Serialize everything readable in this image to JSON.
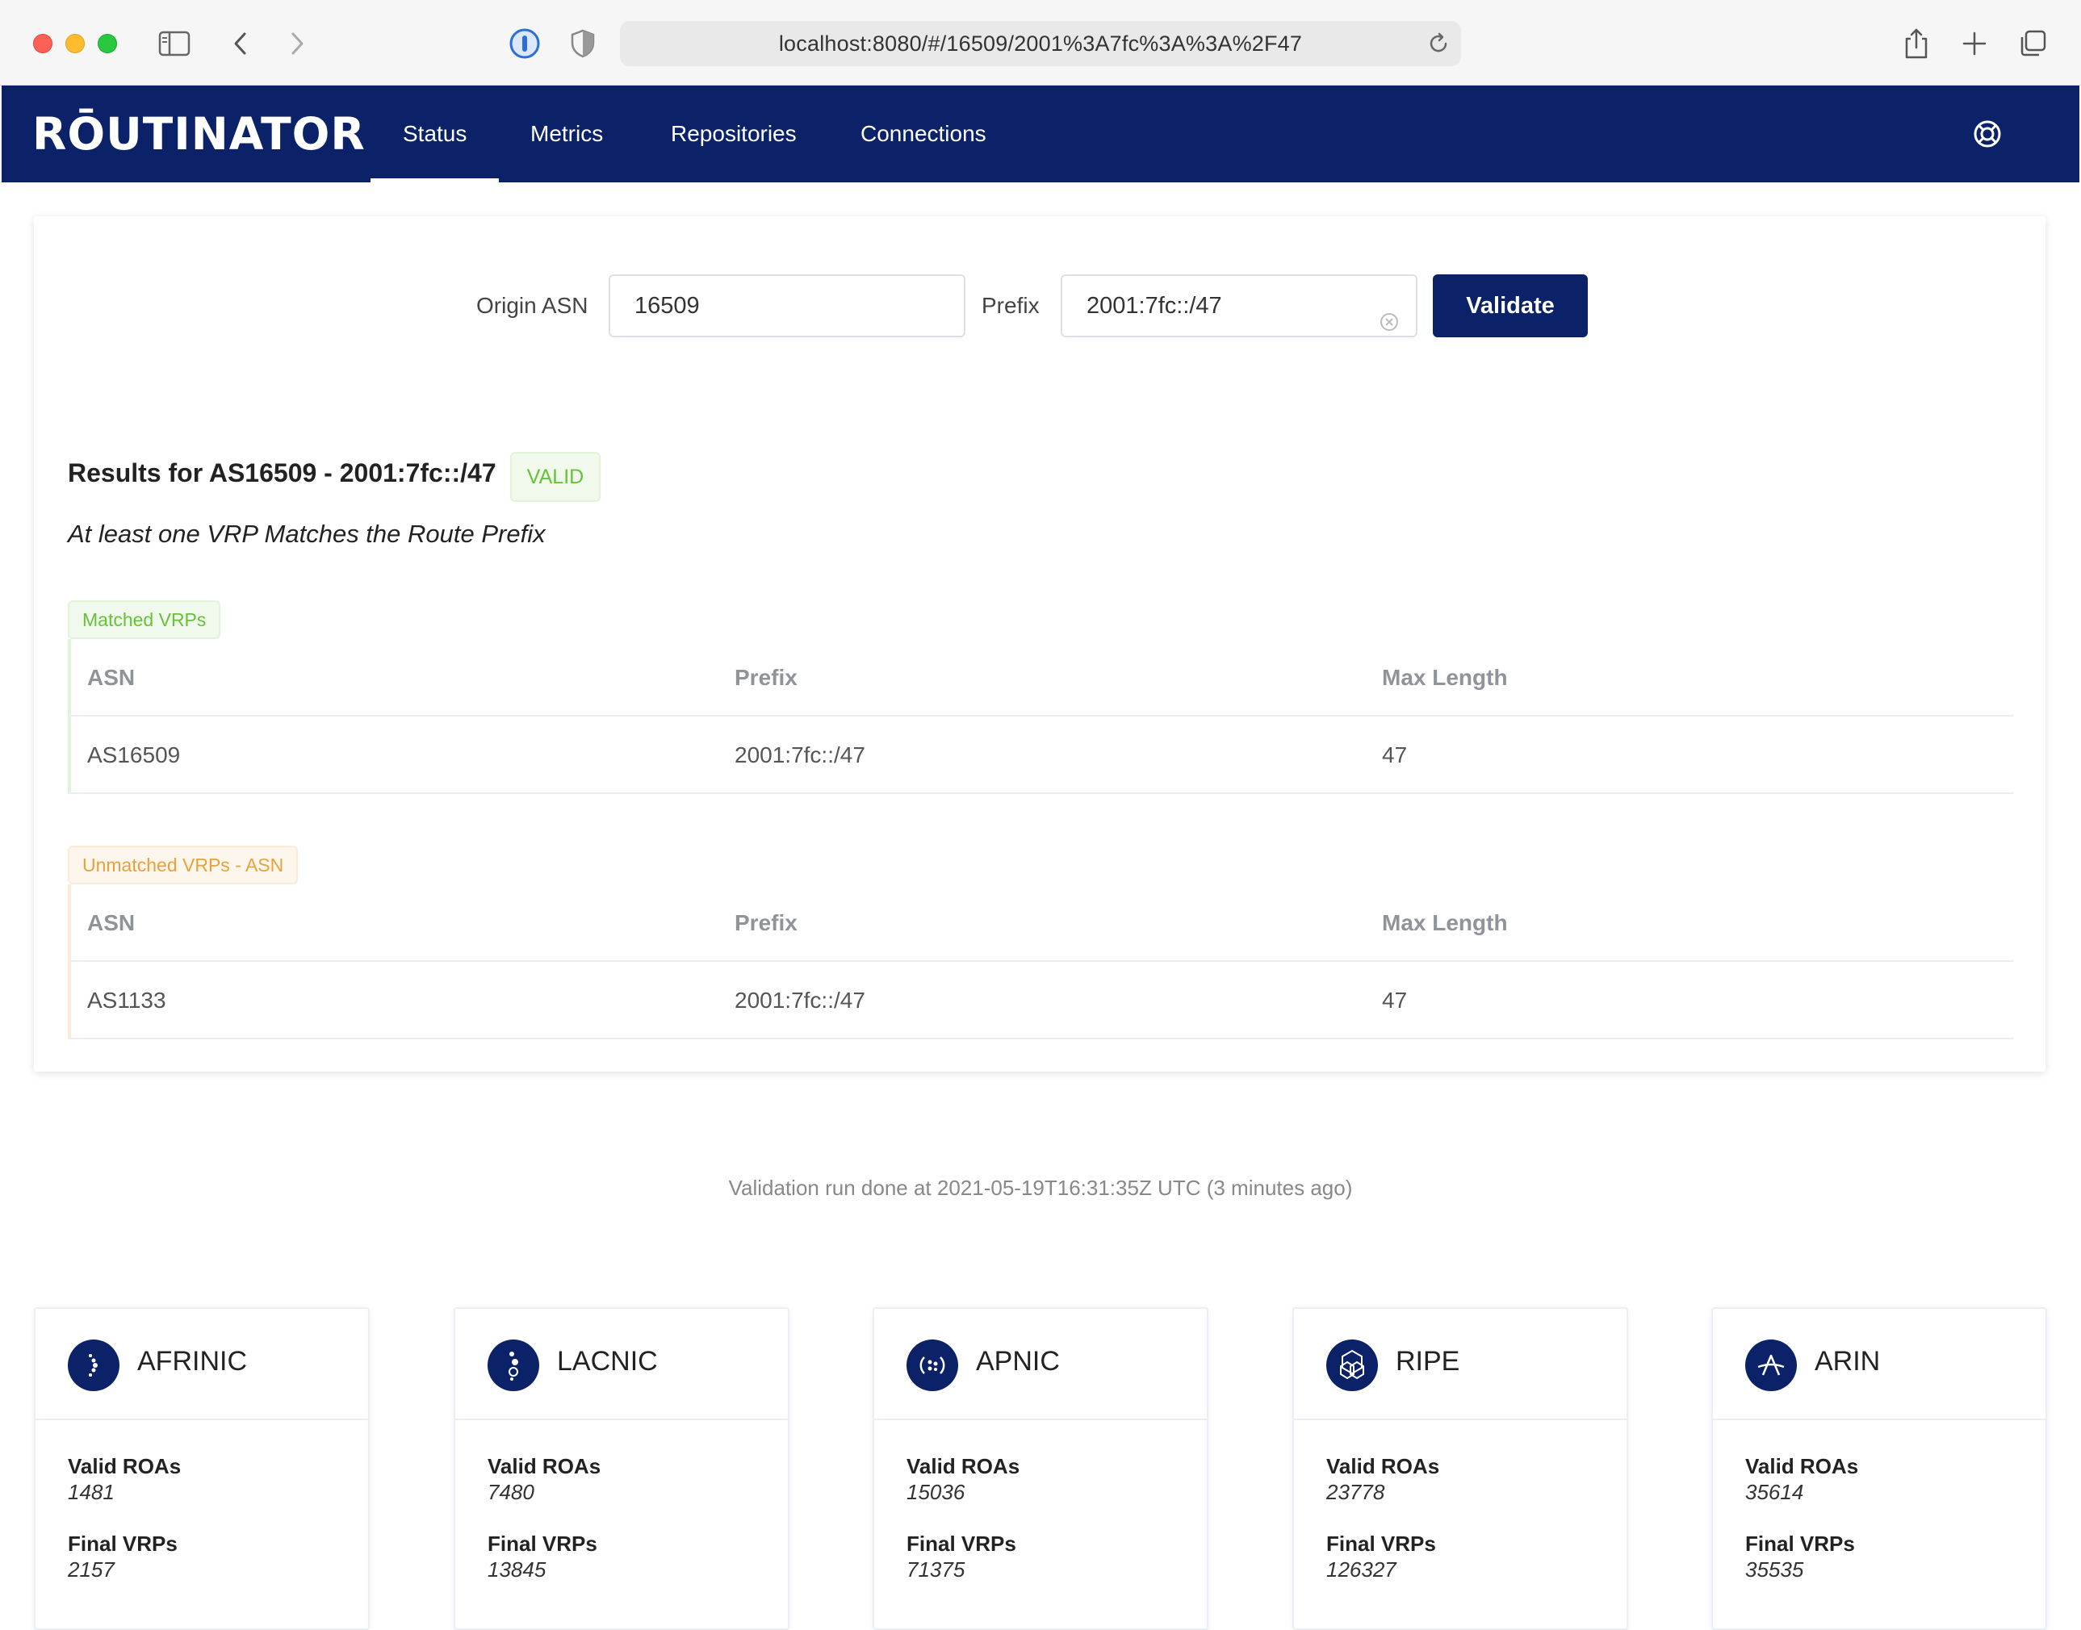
{
  "browser": {
    "url": "localhost:8080/#/16509/2001%3A7fc%3A%3A%2F47"
  },
  "nav": {
    "logo": "RŌUTINATOR",
    "tabs": [
      {
        "label": "Status",
        "active": true
      },
      {
        "label": "Metrics",
        "active": false
      },
      {
        "label": "Repositories",
        "active": false
      },
      {
        "label": "Connections",
        "active": false
      }
    ]
  },
  "form": {
    "asn_label": "Origin ASN",
    "asn_value": "16509",
    "prefix_label": "Prefix",
    "prefix_value": "2001:7fc::/47",
    "validate_label": "Validate"
  },
  "results": {
    "title": "Results for AS16509 - 2001:7fc::/47",
    "state": "VALID",
    "description": "At least one VRP Matches the Route Prefix",
    "matched": {
      "tag": "Matched VRPs",
      "headers": [
        "ASN",
        "Prefix",
        "Max Length"
      ],
      "rows": [
        [
          "AS16509",
          "2001:7fc::/47",
          "47"
        ]
      ]
    },
    "unmatched_asn": {
      "tag": "Unmatched VRPs - ASN",
      "headers": [
        "ASN",
        "Prefix",
        "Max Length"
      ],
      "rows": [
        [
          "AS1133",
          "2001:7fc::/47",
          "47"
        ]
      ]
    }
  },
  "status_line": "Validation run done at 2021-05-19T16:31:35Z UTC (3 minutes ago)",
  "rirs": [
    {
      "name": "AFRINIC",
      "valid_roas_label": "Valid ROAs",
      "valid_roas": "1481",
      "final_vrps_label": "Final VRPs",
      "final_vrps": "2157"
    },
    {
      "name": "LACNIC",
      "valid_roas_label": "Valid ROAs",
      "valid_roas": "7480",
      "final_vrps_label": "Final VRPs",
      "final_vrps": "13845"
    },
    {
      "name": "APNIC",
      "valid_roas_label": "Valid ROAs",
      "valid_roas": "15036",
      "final_vrps_label": "Final VRPs",
      "final_vrps": "71375"
    },
    {
      "name": "RIPE",
      "valid_roas_label": "Valid ROAs",
      "valid_roas": "23778",
      "final_vrps_label": "Final VRPs",
      "final_vrps": "126327"
    },
    {
      "name": "ARIN",
      "valid_roas_label": "Valid ROAs",
      "valid_roas": "35614",
      "final_vrps_label": "Final VRPs",
      "final_vrps": "35535"
    }
  ],
  "colors": {
    "brand": "#0b2268",
    "valid_green": "#67c23a",
    "warn_orange": "#e6a23c"
  },
  "icons": {
    "sidebar": "sidebar-icon",
    "back": "chevron-left-icon",
    "forward": "chevron-right-icon",
    "password": "password-manager-icon",
    "shield": "shield-icon",
    "reload": "reload-icon",
    "share": "share-icon",
    "new_tab": "plus-icon",
    "tabs": "tabs-overview-icon",
    "help": "lifebuoy-icon",
    "clear": "clear-circle-icon"
  }
}
